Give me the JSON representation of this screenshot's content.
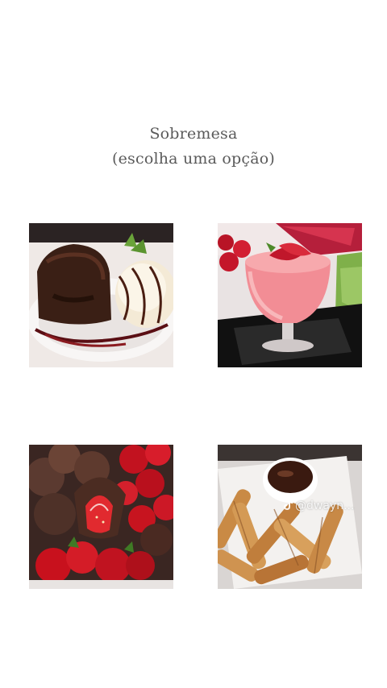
{
  "heading": {
    "line1": "Sobremesa",
    "line2": "(escolha uma opção)"
  },
  "options": [
    {
      "id": "a",
      "icon": "chocolate-lava-cake-with-ice-cream-image"
    },
    {
      "id": "b",
      "icon": "strawberry-mousse-glass-image"
    },
    {
      "id": "c",
      "icon": "chocolate-covered-strawberries-image"
    },
    {
      "id": "d",
      "icon": "churros-with-chocolate-image"
    }
  ],
  "watermark": {
    "handle": "@dwayn..."
  }
}
